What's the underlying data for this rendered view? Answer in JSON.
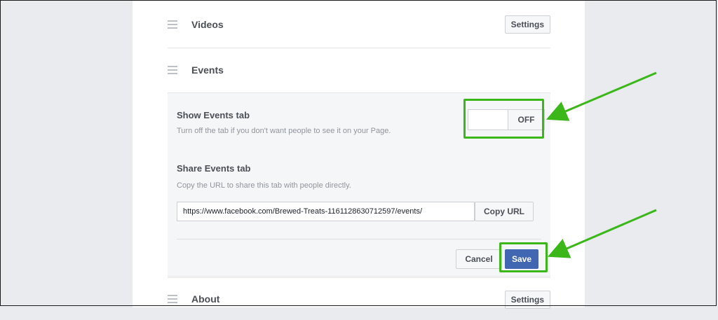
{
  "sections": {
    "videos": {
      "title": "Videos",
      "settings_label": "Settings"
    },
    "events": {
      "title": "Events"
    },
    "about": {
      "title": "About",
      "settings_label": "Settings"
    }
  },
  "events_settings": {
    "show_tab": {
      "label": "Show Events tab",
      "description": "Turn off the tab if you don't want people to see it on your Page.",
      "toggle_state": "OFF"
    },
    "share_tab": {
      "label": "Share Events tab",
      "description": "Copy the URL to share this tab with people directly.",
      "url": "https://www.facebook.com/Brewed-Treats-1161128630712597/events/",
      "copy_label": "Copy URL"
    },
    "cancel_label": "Cancel",
    "save_label": "Save"
  },
  "colors": {
    "highlight": "#3bb71a",
    "primary_button": "#4267b2"
  }
}
